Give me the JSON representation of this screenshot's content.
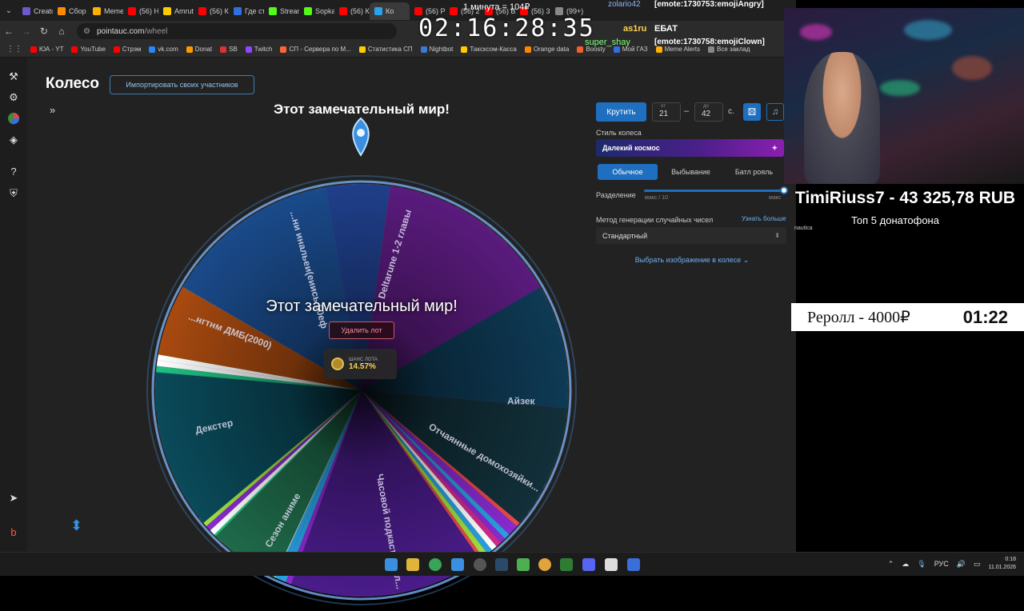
{
  "browser": {
    "tabs": [
      {
        "label": "Creato",
        "color": "#6a5acd"
      },
      {
        "label": "Сбор",
        "color": "#ff8c00"
      },
      {
        "label": "Meme",
        "color": "#ffb000"
      },
      {
        "label": "(56) Н",
        "color": "#ff0000"
      },
      {
        "label": "Amrut",
        "color": "#ffcc00"
      },
      {
        "label": "(56) К",
        "color": "#ff0000"
      },
      {
        "label": "Где ст",
        "color": "#2f6fe0"
      },
      {
        "label": "Stream",
        "color": "#53fc18"
      },
      {
        "label": "Sopka",
        "color": "#53fc18"
      },
      {
        "label": "(56) К",
        "color": "#ff0000"
      },
      {
        "label": "Ко",
        "color": "#2aa3ef",
        "active": true
      },
      {
        "label": "(56) Р",
        "color": "#ff0000"
      },
      {
        "label": "(56) 2",
        "color": "#ff0000"
      },
      {
        "label": "(56) В",
        "color": "#ff0000"
      },
      {
        "label": "(56) 3",
        "color": "#ff0000"
      },
      {
        "label": "(99+)",
        "color": "#888888"
      }
    ],
    "url": "pointauc.com",
    "url_path": "/wheel",
    "bookmarks": [
      {
        "label": "ЮА - YT",
        "color": "#ff0000"
      },
      {
        "label": "YouTube",
        "color": "#ff0000"
      },
      {
        "label": "Стрэм",
        "color": "#ff0000"
      },
      {
        "label": "vk.com",
        "color": "#2787f5"
      },
      {
        "label": "Donat",
        "color": "#ff9900"
      },
      {
        "label": "SB",
        "color": "#e03030"
      },
      {
        "label": "Twitch",
        "color": "#9146ff"
      },
      {
        "label": "СП - Сервера по M...",
        "color": "#ff6633"
      },
      {
        "label": "Статистика СП",
        "color": "#ffcc00"
      },
      {
        "label": "Nightbot",
        "color": "#3a7bd5"
      },
      {
        "label": "Таксксом-Касса",
        "color": "#ffcc00"
      },
      {
        "label": "Orange data",
        "color": "#ff8800"
      },
      {
        "label": "Boosty",
        "color": "#f15f2c"
      },
      {
        "label": "Мой ГАЗ",
        "color": "#2f6fe0"
      },
      {
        "label": "Meme Alerts",
        "color": "#ffb000"
      },
      {
        "label": "Все заклад",
        "color": "#888888"
      }
    ]
  },
  "app": {
    "title": "Колесо",
    "import_button": "Импортировать своих участников",
    "wheel_title": "Этот замечательный мир!",
    "center_name": "Этот замечательный мир!",
    "delete_button": "Удалить лот",
    "chance_caption": "ШАНС ЛОТА",
    "chance_value": "14.57%"
  },
  "controls": {
    "spin_button": "Крутить",
    "from_caption": "от",
    "from_value": "21",
    "to_caption": "до",
    "to_value": "42",
    "seconds_unit": "с.",
    "style_label": "Стиль колеса",
    "style_value": "Далекий космос",
    "modes": [
      {
        "label": "Обычное",
        "active": true
      },
      {
        "label": "Выбывание",
        "active": false
      },
      {
        "label": "Батл рояль",
        "active": false
      }
    ],
    "split_label": "Разделение",
    "split_min": "макс / 10",
    "split_max": "макс",
    "split_value": 1.0,
    "rng_label": "Метод генерации случайных чисел",
    "rng_more": "Узнать больше",
    "rng_value": "Стандартный",
    "image_picker": "Выбрать изображение в колесе"
  },
  "wheel_labels": [
    "Deltarune 1-2 главы",
    "Айзек",
    "Отчаянные домохозяйки...",
    "Часовой подкаст с чел...",
    "Сезон аниме",
    "Декстер",
    "...нгтнм ДМБ(2000)",
    "...ни инальеи(еиись 50еф"
  ],
  "stream": {
    "timer": "02:16:28:35",
    "minute_info": "1 минута = 104₽",
    "chat": [
      {
        "user": "zolario42",
        "message": "[emote:1730753:emojiAngry]"
      },
      {
        "user": "as1ru",
        "message": "ЕБАТ"
      },
      {
        "user": "super_shay",
        "message": "[emote:1730758:emojiClown]"
      }
    ],
    "donate_top": "TimiRiuss7 - 43 325,78 RUB",
    "donate_sub": "Топ  5 донатофона",
    "donate_small": "nautica",
    "reroll_label": "Реролл - 4000₽",
    "reroll_time": "01:22"
  },
  "taskbar": {
    "lang": "РУС",
    "time": "0:18",
    "date": "11.01.2026"
  }
}
